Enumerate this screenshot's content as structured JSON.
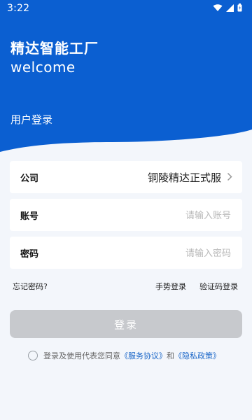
{
  "status_bar": {
    "time": "3:22"
  },
  "header": {
    "title": "精达智能工厂",
    "subtitle": "welcome",
    "section_label": "用户登录"
  },
  "form": {
    "company": {
      "label": "公司",
      "value": "铜陵精达正式服"
    },
    "account": {
      "label": "账号",
      "placeholder": "请输入账号",
      "value": ""
    },
    "password": {
      "label": "密码",
      "placeholder": "请输入密码",
      "value": ""
    }
  },
  "links": {
    "forgot_password": "忘记密码?",
    "gesture_login": "手势登录",
    "sms_login": "验证码登录"
  },
  "login_button": "登录",
  "agreement": {
    "prefix": "登录及使用代表您同意",
    "service": "《服务协议》",
    "and": "和",
    "privacy": "《隐私政策》",
    "checked": false
  },
  "colors": {
    "header_blue": "#0b5fd1",
    "link_blue": "#1a66c8",
    "button_disabled": "#c7c9cd",
    "page_bg": "#f3f6fb"
  },
  "icons": [
    "wifi-icon",
    "signal-icon",
    "battery-icon",
    "chevron-right-icon"
  ]
}
